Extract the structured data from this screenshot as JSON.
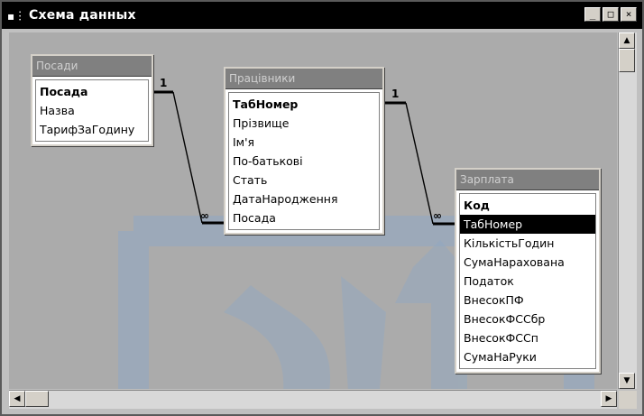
{
  "window": {
    "title": "Схема данных"
  },
  "tables": [
    {
      "title": "Посади",
      "fields": [
        "Посада",
        "Назва",
        "ТарифЗаГодину"
      ],
      "key_index": 0,
      "selected_index": -1
    },
    {
      "title": "Працівники",
      "fields": [
        "ТабНомер",
        "Прізвище",
        "Ім'я",
        "По-батькові",
        "Стать",
        "ДатаНародження",
        "Посада"
      ],
      "key_index": 0,
      "selected_index": -1
    },
    {
      "title": "Зарплата",
      "fields": [
        "Код",
        "ТабНомер",
        "КількістьГодин",
        "СумаНарахована",
        "Податок",
        "ВнесокПФ",
        "ВнесокФССбр",
        "ВнесокФССп",
        "СумаНаРуки"
      ],
      "key_index": 0,
      "selected_index": 1
    }
  ],
  "relations": [
    {
      "one": "1",
      "many": "∞"
    },
    {
      "one": "1",
      "many": "∞"
    }
  ],
  "icons": {
    "sysmenu": "system-menu-icon",
    "minimize": "minimize-icon",
    "maximize": "maximize-icon",
    "close": "close-icon"
  },
  "colors": {
    "titlebar": "#000000",
    "canvas": "#ababab",
    "watermark": "#8aa6c6",
    "selection": "#000000"
  }
}
